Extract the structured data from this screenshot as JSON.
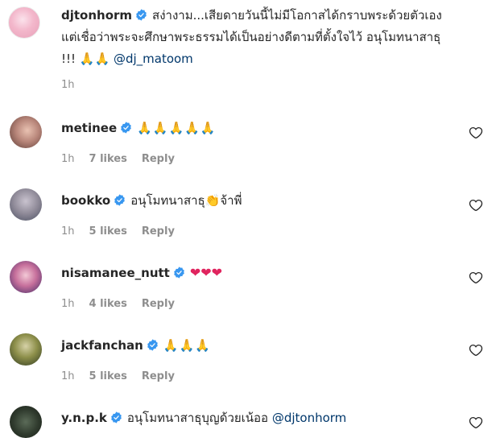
{
  "caption": {
    "username": "djtonhorm",
    "text_line1": "สง่างาม...เสียดายวันนี้ไม่มีโอกาสได้กราบพระด้วยตัวเอง",
    "text_line2": "แต่เชื่อว่าพระจะศึกษาพระธรรมได้เป็นอย่างดีตามที่ตั้งใจไว้ อนุโมทนาสาธุ",
    "text_line3": "!!! 🙏🙏",
    "mention": "@dj_matoom",
    "time": "1h"
  },
  "comments": [
    {
      "username": "metinee",
      "verified": true,
      "text": "🙏🙏🙏🙏🙏",
      "time": "1h",
      "likes": "7 likes",
      "reply": "Reply"
    },
    {
      "username": "bookko",
      "verified": true,
      "text": "อนุโมทนาสาธุ👏จ้าพี่",
      "time": "1h",
      "likes": "5 likes",
      "reply": "Reply"
    },
    {
      "username": "nisamanee_nutt",
      "verified": true,
      "text": "❤❤❤",
      "time": "1h",
      "likes": "4 likes",
      "reply": "Reply"
    },
    {
      "username": "jackfanchan",
      "verified": true,
      "text": "🙏🙏🙏",
      "time": "1h",
      "likes": "5 likes",
      "reply": "Reply"
    },
    {
      "username": "y.n.p.k",
      "verified": true,
      "text": "อนุโมทนาสาธุบุญด้วยเน้ออ",
      "mention": "@djtonhorm"
    }
  ],
  "colors": {
    "verified": "#3897f0",
    "secondary": "#8e8e8e",
    "mention": "#00376b"
  }
}
